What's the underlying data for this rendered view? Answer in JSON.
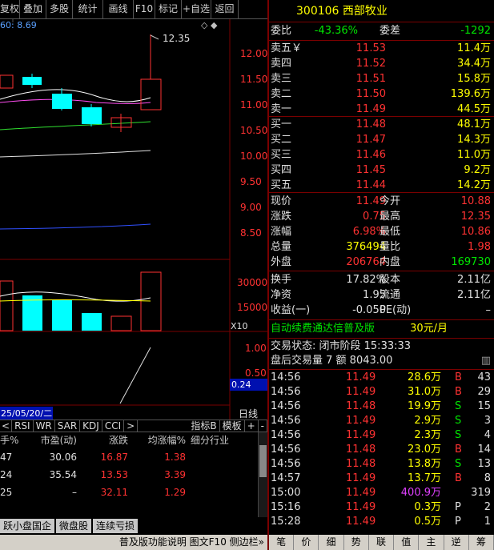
{
  "toolbar": [
    "复权",
    "叠加",
    "多股",
    "统计",
    "画线",
    "F10",
    "标记",
    "+自选",
    "返回"
  ],
  "chart": {
    "ma_label": "60: 8.69",
    "high_label": "12.35",
    "price_ticks": [
      "12.00",
      "11.50",
      "11.00",
      "10.50",
      "10.00",
      "9.50",
      "9.00",
      "8.50"
    ],
    "vol_ticks": [
      "30000",
      "15000"
    ],
    "vol_scale": "X10",
    "ind_ticks": [
      "1.00",
      "0.50"
    ],
    "ind_value": "0.24",
    "date_label": "25/05/20/二",
    "period_label": "日线"
  },
  "indicators": [
    "RSI",
    "WR",
    "SAR",
    "KDJ",
    "CCI",
    ">"
  ],
  "ind_right": [
    "指标B",
    "模板",
    "+",
    "-"
  ],
  "table": {
    "headers": [
      "手%",
      "市盈(动)",
      "涨跌",
      "均涨幅%",
      "细分行业"
    ],
    "rows": [
      [
        "47",
        "30.06",
        "16.87",
        "1.38",
        ""
      ],
      [
        "24",
        "35.54",
        "13.53",
        "3.39",
        ""
      ],
      [
        "25",
        "–",
        "32.11",
        "1.29",
        ""
      ]
    ]
  },
  "sheet_tabs": [
    "跃小盘国企",
    "微盘股",
    "连续亏损"
  ],
  "bottom_bar": "普及版功能说明  图文F10  侧边栏»",
  "stock": {
    "code": "300106",
    "name": "西部牧业"
  },
  "weibi": {
    "l1": "委比",
    "v1": "-43.36%",
    "l2": "委差",
    "v2": "-1292"
  },
  "sells": [
    [
      "卖五￥",
      "11.53",
      "11.4万"
    ],
    [
      "卖四",
      "11.52",
      "34.4万"
    ],
    [
      "卖三",
      "11.51",
      "15.8万"
    ],
    [
      "卖二",
      "11.50",
      "139.6万"
    ],
    [
      "卖一",
      "11.49",
      "44.5万"
    ]
  ],
  "buys": [
    [
      "买一",
      "11.48",
      "48.1万"
    ],
    [
      "买二",
      "11.47",
      "14.3万"
    ],
    [
      "买三",
      "11.46",
      "11.0万"
    ],
    [
      "买四",
      "11.45",
      "9.2万"
    ],
    [
      "买五",
      "11.44",
      "14.2万"
    ]
  ],
  "stats": [
    [
      "现价",
      "11.49",
      "今开",
      "10.88"
    ],
    [
      "涨跌",
      "0.75",
      "最高",
      "12.35"
    ],
    [
      "涨幅",
      "6.98%",
      "最低",
      "10.86"
    ],
    [
      "总量",
      "376494",
      "量比",
      "1.98"
    ],
    [
      "外盘",
      "206764",
      "内盘",
      "169730"
    ]
  ],
  "stats2": [
    [
      "换手",
      "17.82%",
      "股本",
      "2.11亿"
    ],
    [
      "净资",
      "1.95",
      "流通",
      "2.11亿"
    ],
    [
      "收益(一)",
      "-0.050",
      "PE(动)",
      "–"
    ]
  ],
  "ad": {
    "text": "自动续费通达信普及版",
    "price": "30元/月"
  },
  "trade_status": "交易状态: 闭市阶段 15:33:33",
  "after_hours": "盘后交易量 7 额 8043.00",
  "trades": [
    [
      "14:56",
      "11.49",
      "28.6万",
      "B",
      "43"
    ],
    [
      "14:56",
      "11.49",
      "31.0万",
      "B",
      "29"
    ],
    [
      "14:56",
      "11.48",
      "19.9万",
      "S",
      "15"
    ],
    [
      "14:56",
      "11.49",
      "2.9万",
      "S",
      "3"
    ],
    [
      "14:56",
      "11.49",
      "2.3万",
      "S",
      "4"
    ],
    [
      "14:56",
      "11.48",
      "23.0万",
      "B",
      "14"
    ],
    [
      "14:56",
      "11.48",
      "13.8万",
      "S",
      "13"
    ],
    [
      "14:57",
      "11.49",
      "13.7万",
      "B",
      "8"
    ],
    [
      "15:00",
      "11.49",
      "400.9万",
      "",
      "319"
    ],
    [
      "15:16",
      "11.49",
      "0.3万",
      "P",
      "2"
    ],
    [
      "15:28",
      "11.49",
      "0.5万",
      "P",
      "1"
    ]
  ],
  "bottom_tabs": [
    "笔",
    "价",
    "细",
    "势",
    "联",
    "值",
    "主",
    "逆",
    "筹"
  ]
}
